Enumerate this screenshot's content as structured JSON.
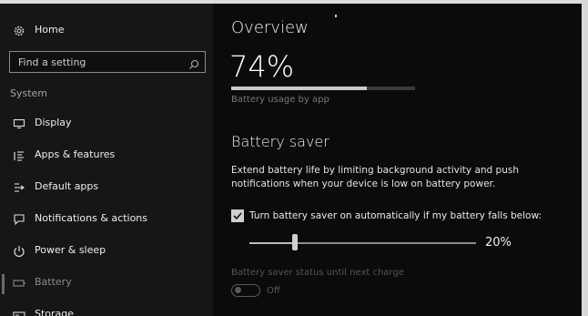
{
  "sidebar": {
    "home_label": "Home",
    "search_placeholder": "Find a setting",
    "section_label": "System",
    "items": [
      {
        "label": "Display",
        "icon": "display-icon"
      },
      {
        "label": "Apps & features",
        "icon": "apps-list-icon"
      },
      {
        "label": "Default apps",
        "icon": "default-apps-icon"
      },
      {
        "label": "Notifications & actions",
        "icon": "notification-icon"
      },
      {
        "label": "Power & sleep",
        "icon": "power-icon"
      },
      {
        "label": "Battery",
        "icon": "battery-icon",
        "selected": true
      },
      {
        "label": "Storage",
        "icon": "storage-icon"
      }
    ]
  },
  "overview": {
    "title": "Overview",
    "percent": "74%",
    "level": 0.74,
    "usage_link": "Battery usage by app"
  },
  "battery_saver": {
    "title": "Battery saver",
    "description": "Extend battery life by limiting background activity and push notifications when your device is low on battery power.",
    "checkbox_label": "Turn battery saver on automatically if my battery falls below:",
    "checkbox_checked": true,
    "threshold_percent": 20,
    "threshold_label": "20%",
    "status_label": "Battery saver status until next charge",
    "toggle_state": "Off"
  },
  "colors": {
    "background": "#0b0b0b",
    "sidebar": "#161616",
    "text": "#e6e6e6",
    "dim_text": "#555555"
  }
}
